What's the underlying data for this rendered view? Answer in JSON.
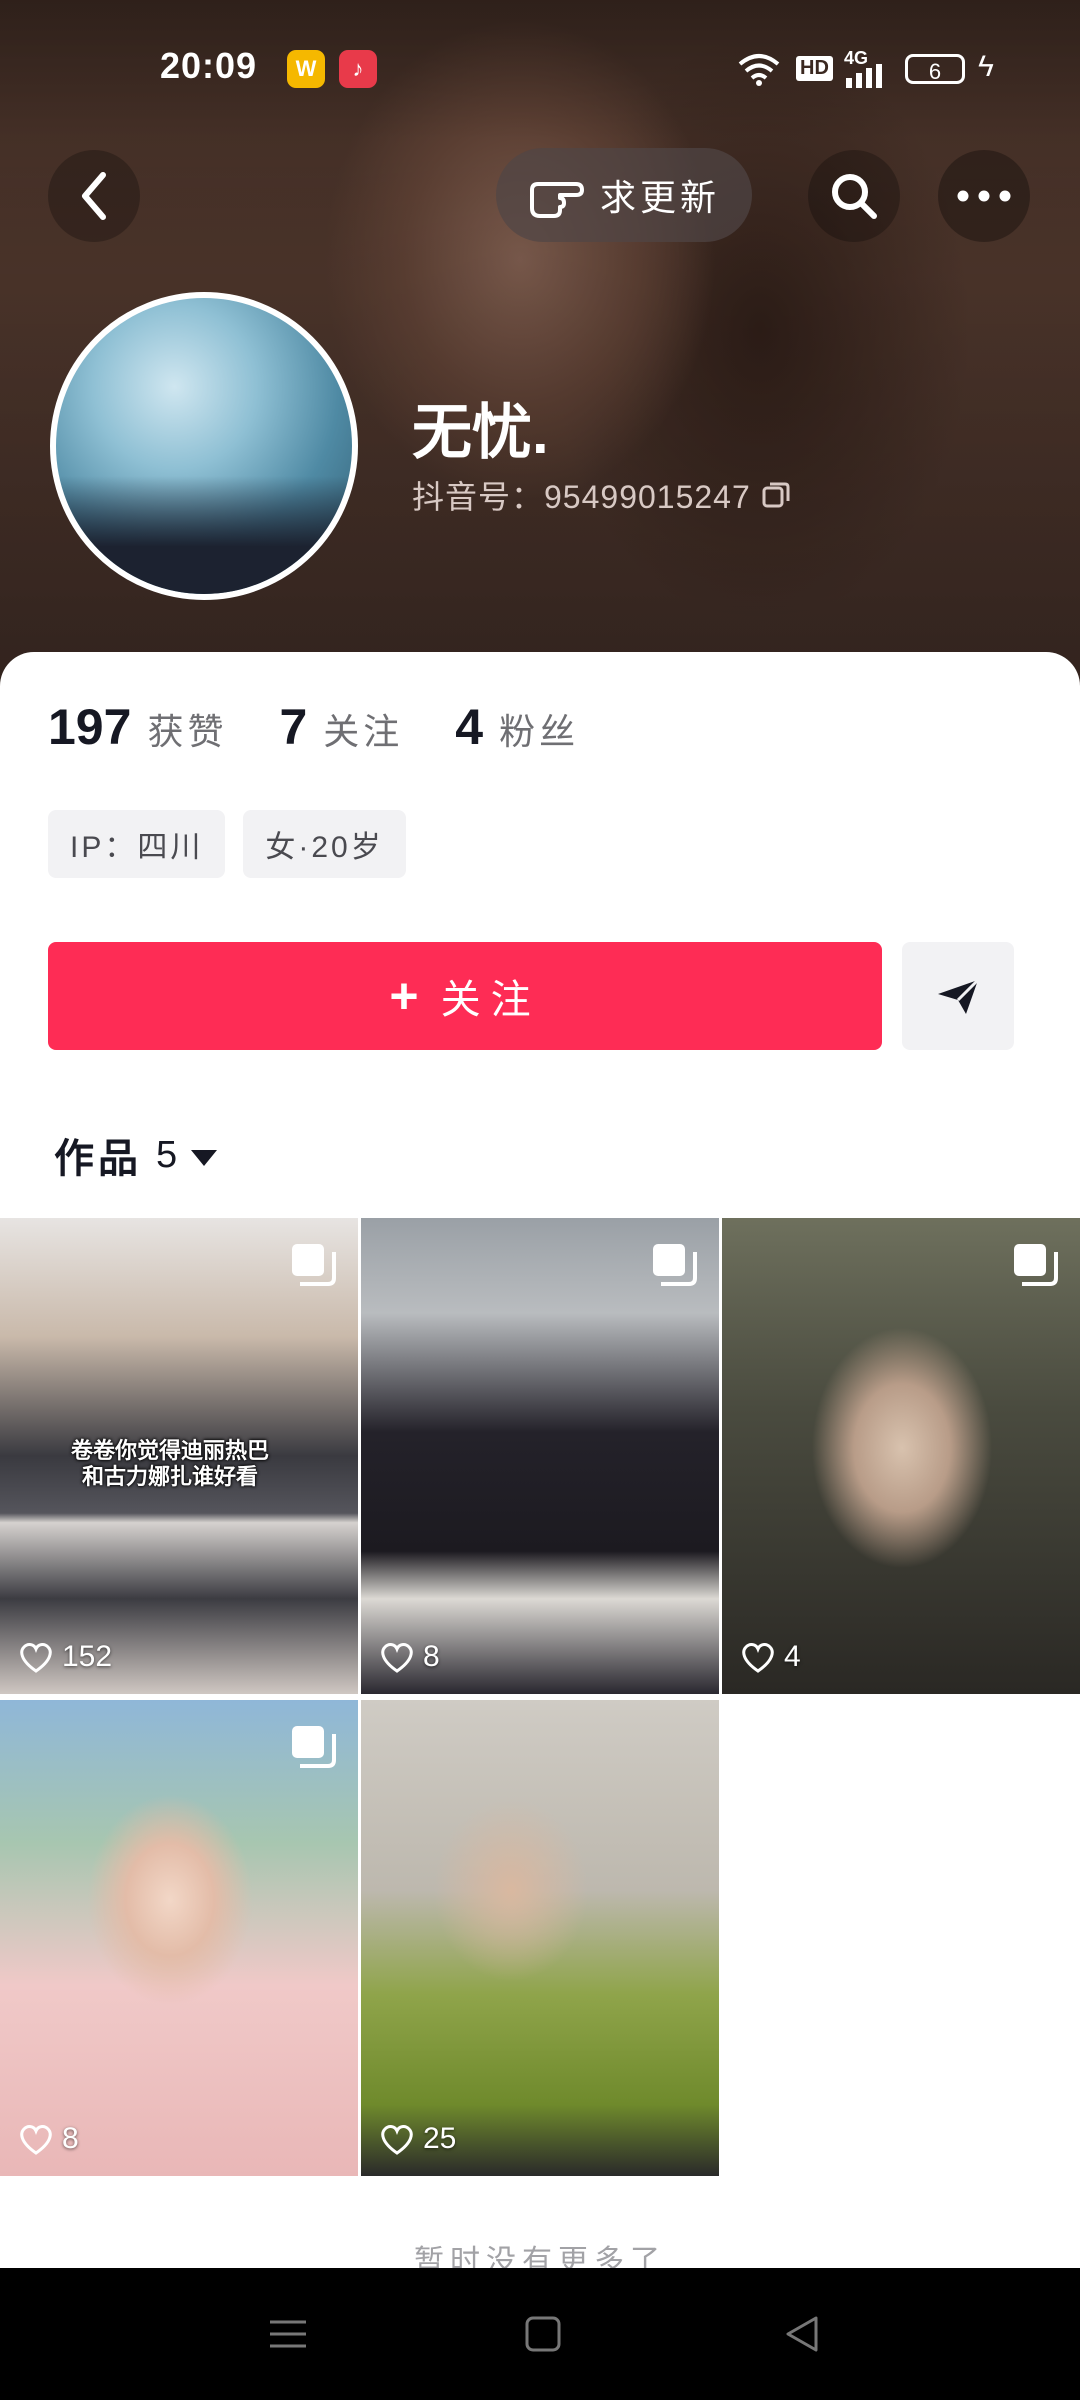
{
  "status_bar": {
    "time": "20:09",
    "network": "HD",
    "cellular": "4G",
    "battery": "6"
  },
  "top_nav": {
    "refresh_label": "求更新"
  },
  "profile": {
    "nickname": "无忧.",
    "douyin_id": "抖音号：95499015247"
  },
  "stats": [
    {
      "value": "197",
      "label": "获赞"
    },
    {
      "value": "7",
      "label": "关注"
    },
    {
      "value": "4",
      "label": "粉丝"
    }
  ],
  "tags": [
    "IP：四川",
    "女·20岁"
  ],
  "actions": {
    "follow_label": "关注"
  },
  "works": {
    "tab_label": "作品",
    "count": "5",
    "items": [
      {
        "likes": "152",
        "caption": "卷卷你觉得迪丽热巴\n和古力娜扎谁好看",
        "multi": true
      },
      {
        "likes": "8",
        "multi": true
      },
      {
        "likes": "4",
        "multi": true
      },
      {
        "likes": "8",
        "multi": true
      },
      {
        "likes": "25",
        "multi": false
      }
    ]
  },
  "footer_text": "暂时没有更多了",
  "colors": {
    "follow_red": "#fe2c55",
    "text_primary": "#161823",
    "tag_bg": "#f2f2f4"
  }
}
